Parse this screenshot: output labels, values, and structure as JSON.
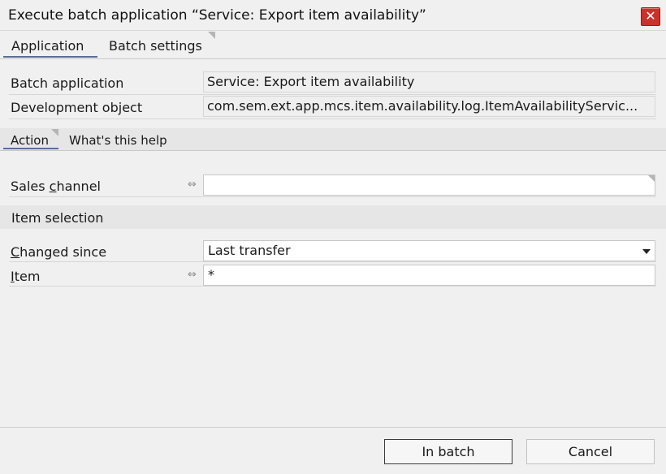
{
  "window": {
    "title": "Execute batch application “Service: Export item availability”",
    "close_label": "✕"
  },
  "main_tabs": [
    {
      "label": "Application",
      "active": true
    },
    {
      "label": "Batch settings",
      "active": false
    }
  ],
  "info": {
    "batch_application": {
      "label": "Batch application",
      "value": "Service: Export item availability"
    },
    "development_object": {
      "label": "Development object",
      "value": "com.sem.ext.app.mcs.item.availability.log.ItemAvailabilityServic..."
    }
  },
  "sub_tabs": [
    {
      "label": "Action",
      "active": true
    },
    {
      "label": "What's this help",
      "active": false
    }
  ],
  "form": {
    "sales_channel": {
      "label_pre": "Sales ",
      "label_accel": "c",
      "label_post": "hannel",
      "value": ""
    },
    "item_selection": {
      "title": "Item selection"
    },
    "changed_since": {
      "label_pre": "",
      "label_accel": "C",
      "label_post": "hanged since",
      "value": "Last transfer"
    },
    "item": {
      "label_pre": "",
      "label_accel": "I",
      "label_post": "tem",
      "value": "*"
    },
    "link_icon_glyph": "⇔"
  },
  "buttons": {
    "in_batch": "In batch",
    "cancel": "Cancel"
  },
  "colors": {
    "accent": "#5a6e95",
    "close": "#c7332b"
  }
}
